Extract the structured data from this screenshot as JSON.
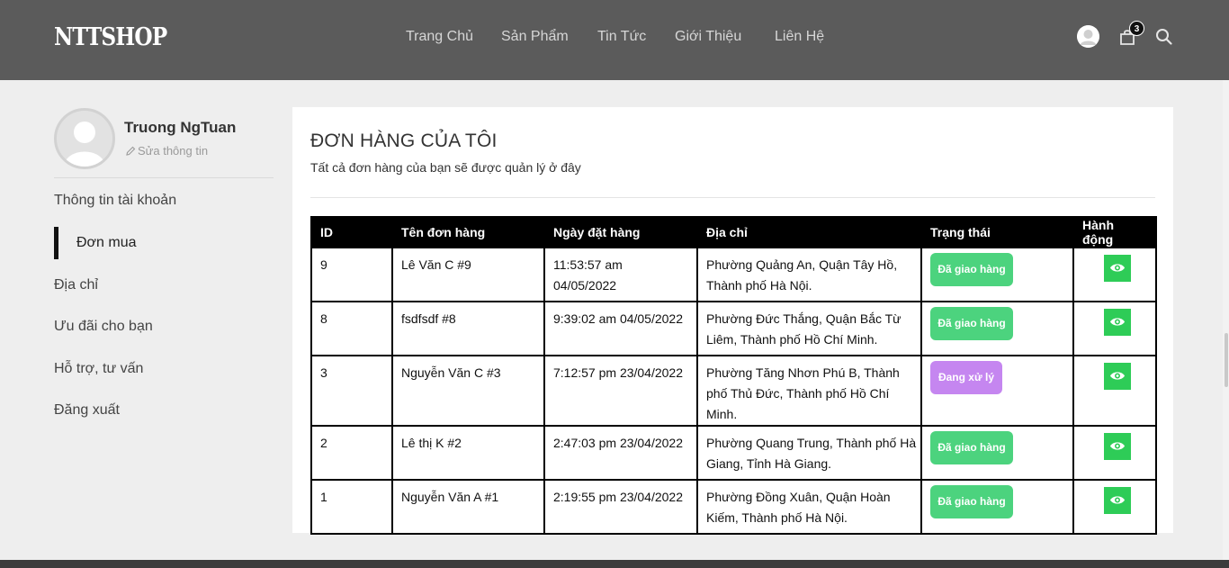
{
  "brand": {
    "logo": "NTTSHOP"
  },
  "nav": {
    "items": [
      {
        "label": "Trang Chủ"
      },
      {
        "label": "Sản Phẩm"
      },
      {
        "label": "Tin Tức"
      },
      {
        "label": "Giới Thiệu"
      },
      {
        "label": "Liên Hệ"
      }
    ]
  },
  "header_icons": {
    "user": "user-icon",
    "cart": "cart-icon",
    "cart_count": "3",
    "search": "search-icon"
  },
  "profile": {
    "name": "Truong NgTuan",
    "edit_label": "Sửa thông tin",
    "edit_icon": "pencil-icon"
  },
  "sidebar": {
    "items": [
      {
        "label": "Thông tin tài khoản"
      },
      {
        "label": "Đơn mua",
        "active": true
      },
      {
        "label": "Địa chỉ"
      },
      {
        "label": "Ưu đãi cho bạn"
      },
      {
        "label": "Hỗ trợ, tư vấn"
      },
      {
        "label": "Đăng xuất"
      }
    ]
  },
  "orders": {
    "title": "ĐƠN HÀNG CỦA TÔI",
    "subtitle": "Tất cả đơn hàng của bạn sẽ được quản lý ở đây",
    "columns": [
      "ID",
      "Tên đơn hàng",
      "Ngày đặt hàng",
      "Địa chỉ",
      "Trạng thái",
      "Hành động"
    ],
    "rows": [
      {
        "id": "9",
        "name": "Lê Văn C #9",
        "date": "11:53:57 am 04/05/2022",
        "address": "Phường Quảng An, Quận Tây Hồ, Thành phố Hà Nội.",
        "status": "Đã giao hàng",
        "status_type": "delivered",
        "action_icon": "eye-icon"
      },
      {
        "id": "8",
        "name": "fsdfsdf #8",
        "date": "9:39:02 am 04/05/2022",
        "address": "Phường Đức Thắng, Quận Bắc Từ Liêm, Thành phố Hồ Chí Minh.",
        "status": "Đã giao hàng",
        "status_type": "delivered",
        "action_icon": "eye-icon"
      },
      {
        "id": "3",
        "name": "Nguyễn Văn C #3",
        "date": "7:12:57 pm 23/04/2022",
        "address": "Phường Tăng Nhơn Phú B, Thành phố Thủ Đức, Thành phố Hồ Chí Minh.",
        "status": "Đang xử lý",
        "status_type": "processing",
        "action_icon": "eye-icon"
      },
      {
        "id": "2",
        "name": "Lê thị K #2",
        "date": "2:47:03 pm 23/04/2022",
        "address": "Phường Quang Trung, Thành phố Hà Giang, Tỉnh Hà Giang.",
        "status": "Đã giao hàng",
        "status_type": "delivered",
        "action_icon": "eye-icon"
      },
      {
        "id": "1",
        "name": "Nguyễn Văn A #1",
        "date": "2:19:55 pm 23/04/2022",
        "address": "Phường Đồng Xuân, Quận Hoàn Kiếm, Thành phố Hà Nội.",
        "status": "Đã giao hàng",
        "status_type": "delivered",
        "action_icon": "eye-icon"
      }
    ]
  },
  "colors": {
    "header_bg": "#5b5b5b",
    "page_bg": "#eeeeee",
    "delivered": "#4cd37e",
    "processing": "#c586f0",
    "action": "#2ecc57"
  }
}
